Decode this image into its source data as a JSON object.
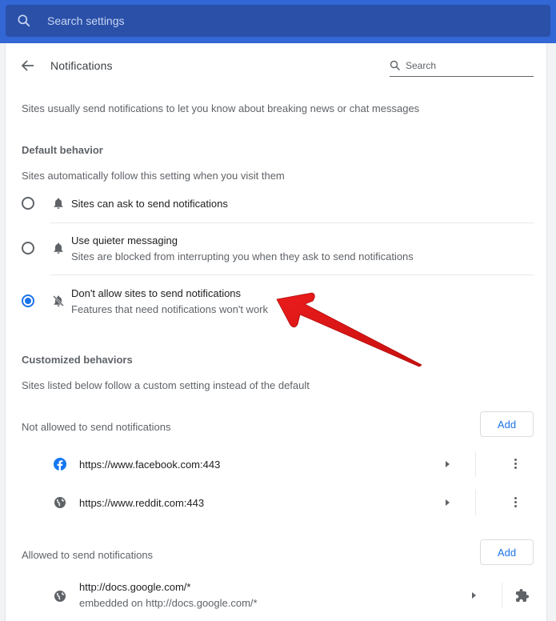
{
  "topbar": {
    "search_placeholder": "Search settings",
    "search_icon": "search-icon"
  },
  "header": {
    "back_icon": "arrow-back-icon",
    "title": "Notifications",
    "search_placeholder": "Search",
    "search_icon": "search-icon"
  },
  "intro": "Sites usually send notifications to let you know about breaking news or chat messages",
  "default_behavior": {
    "heading": "Default behavior",
    "description": "Sites automatically follow this setting when you visit them",
    "options": [
      {
        "title": "Sites can ask to send notifications",
        "subtitle": "",
        "icon": "bell-icon",
        "selected": false
      },
      {
        "title": "Use quieter messaging",
        "subtitle": "Sites are blocked from interrupting you when they ask to send notifications",
        "icon": "bell-icon",
        "selected": false
      },
      {
        "title": "Don't allow sites to send notifications",
        "subtitle": "Features that need notifications won't work",
        "icon": "bell-off-icon",
        "selected": true
      }
    ]
  },
  "customized": {
    "heading": "Customized behaviors",
    "description": "Sites listed below follow a custom setting instead of the default",
    "blocked": {
      "label": "Not allowed to send notifications",
      "add_label": "Add",
      "sites": [
        {
          "url": "https://www.facebook.com:443",
          "icon": "facebook-icon"
        },
        {
          "url": "https://www.reddit.com:443",
          "icon": "globe-icon"
        }
      ]
    },
    "allowed": {
      "label": "Allowed to send notifications",
      "add_label": "Add",
      "sites": [
        {
          "url": "http://docs.google.com/*",
          "subtitle": "embedded on http://docs.google.com/*",
          "icon": "globe-icon",
          "action_icon": "extension-puzzle-icon"
        }
      ]
    }
  },
  "annotation": {
    "type": "red-arrow",
    "color": "#e01b1b",
    "points_to": "Don't allow sites to send notifications"
  },
  "colors": {
    "topbar": "#3367d6",
    "searchbox": "#2a50a8",
    "accent": "#1a73e8"
  }
}
